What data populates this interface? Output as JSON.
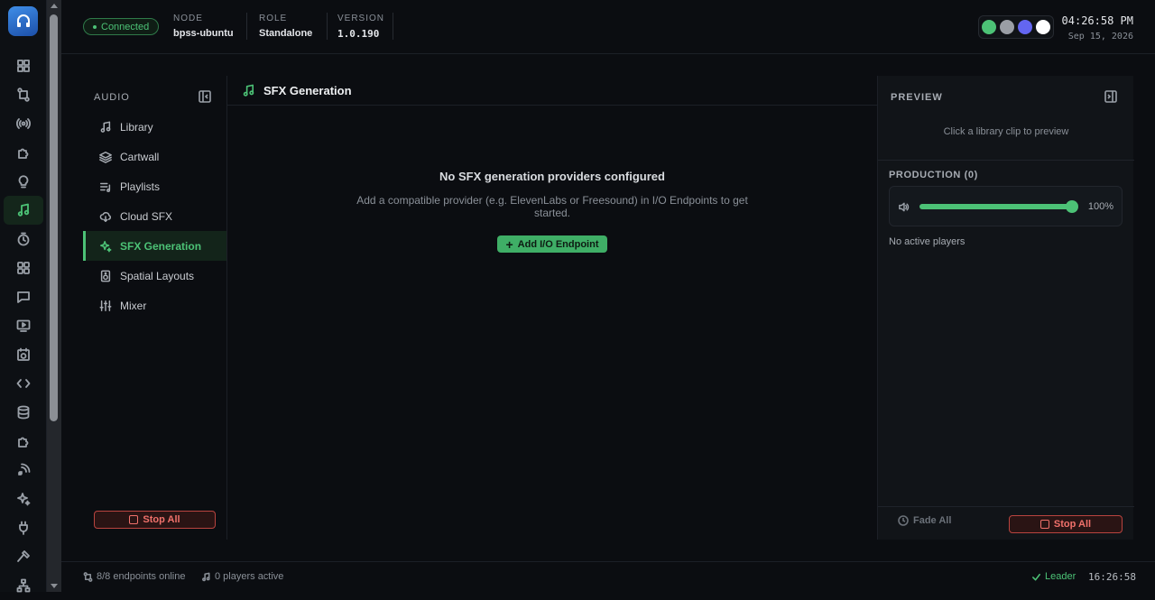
{
  "header": {
    "connection": "Connected",
    "node_label": "NODE",
    "node_value": "bpss-ubuntu",
    "role_label": "ROLE",
    "role_value": "Standalone",
    "version_label": "VERSION",
    "version_value": "1.0.190",
    "time": "04:26:58 PM",
    "date": "Sep 15, 2026",
    "swatch_colors": [
      "#4cc276",
      "#9a9ea5",
      "#6366f1",
      "#ffffff"
    ]
  },
  "rail": {
    "icons": [
      "dashboard-icon",
      "routing-icon",
      "broadcast-icon",
      "plugin-icon",
      "idea-icon",
      "music-icon",
      "timer-icon",
      "apps-icon",
      "chat-icon",
      "display-icon",
      "schedule-icon",
      "code-icon",
      "database-icon",
      "extensions-icon",
      "satellite-icon",
      "ai-sparkle-icon",
      "plug-icon",
      "tools-icon",
      "network-icon"
    ],
    "active_index": 5
  },
  "audio_nav": {
    "heading": "AUDIO",
    "items": [
      {
        "label": "Library",
        "icon": "music-note-icon"
      },
      {
        "label": "Cartwall",
        "icon": "layers-icon"
      },
      {
        "label": "Playlists",
        "icon": "playlist-icon"
      },
      {
        "label": "Cloud SFX",
        "icon": "cloud-download-icon"
      },
      {
        "label": "SFX Generation",
        "icon": "sparkle-icon"
      },
      {
        "label": "Spatial Layouts",
        "icon": "speaker-icon"
      },
      {
        "label": "Mixer",
        "icon": "sliders-icon"
      }
    ],
    "active_index": 4,
    "stop_all": "Stop All"
  },
  "content": {
    "title": "SFX Generation",
    "empty_title": "No SFX generation providers configured",
    "empty_desc": "Add a compatible provider (e.g. ElevenLabs or Freesound) in I/O Endpoints to get started.",
    "add_button": "Add I/O Endpoint"
  },
  "preview": {
    "heading": "PREVIEW",
    "hint": "Click a library clip to preview",
    "production_heading": "PRODUCTION (0)",
    "volume_text": "100%",
    "volume_level": 1.0,
    "no_players": "No active players",
    "fade_all": "Fade All",
    "stop_all": "Stop All"
  },
  "statusbar": {
    "endpoints": "8/8 endpoints online",
    "players": "0 players active",
    "leader": "Leader",
    "time": "16:26:58"
  }
}
